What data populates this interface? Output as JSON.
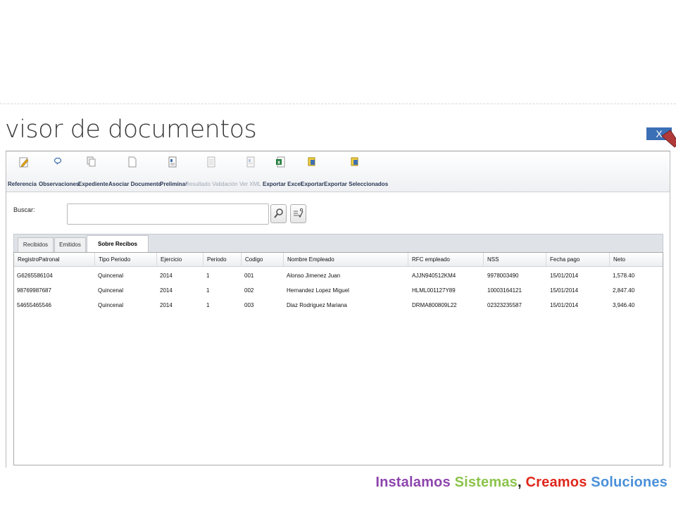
{
  "page": {
    "title": "visor de documentos",
    "close_label": "X"
  },
  "toolbar": [
    {
      "label": "Referencia",
      "icon": "pencil-icon",
      "enabled": true
    },
    {
      "label": "Observaciones",
      "icon": "comment-icon",
      "enabled": true
    },
    {
      "label": "Expediente",
      "icon": "copy-icon",
      "enabled": true
    },
    {
      "label": "Asociar Documento",
      "icon": "document-icon",
      "enabled": true
    },
    {
      "label": "Preliminar",
      "icon": "preview-icon",
      "enabled": true
    },
    {
      "label": "Resultado Validación",
      "icon": "validation-icon",
      "enabled": false
    },
    {
      "label": "Ver XML",
      "icon": "xml-icon",
      "enabled": false
    },
    {
      "label": "Exportar Excel",
      "icon": "excel-icon",
      "enabled": true
    },
    {
      "label": "Exportar",
      "icon": "export-icon",
      "enabled": true
    },
    {
      "label": "Exportar Seleccionados",
      "icon": "export-selected-icon",
      "enabled": true
    }
  ],
  "search": {
    "label": "Buscar:",
    "value": "",
    "placeholder": ""
  },
  "tabs": [
    {
      "label": "Recibidos",
      "active": false
    },
    {
      "label": "Emitidos",
      "active": false
    },
    {
      "label": "Sobre Recibos",
      "active": true
    }
  ],
  "grid": {
    "columns": [
      "RegistroPatronal",
      "Tipo Periodo",
      "Ejercicio",
      "Periodo",
      "Codigo",
      "Nombre Empleado",
      "RFC empleado",
      "NSS",
      "Fecha pago",
      "Neto"
    ],
    "rows": [
      [
        "G6265586104",
        "Quincenal",
        "2014",
        "1",
        "001",
        "Alonso Jimenez Juan",
        "AJJN940512KM4",
        "9978003490",
        "15/01/2014",
        "1,578.40"
      ],
      [
        "98769987687",
        "Quincenal",
        "2014",
        "1",
        "002",
        "Hernandez Lopez Miguel",
        "HLML001127Y89",
        "10003164121",
        "15/01/2014",
        "2,847.40"
      ],
      [
        "54655465546",
        "Quincenal",
        "2014",
        "1",
        "003",
        "Diaz Rodriguez Mariana",
        "DRMA800809L22",
        "02323235587",
        "15/01/2014",
        "3,946.40"
      ]
    ]
  },
  "slogan": {
    "word1": "Instalamos",
    "word2": "Sistemas",
    "comma": ",",
    "word3": "Creamos",
    "word4": "Soluciones",
    "colors": {
      "word1": "#8e44ad",
      "word2": "#8bc34a",
      "comma": "#222222",
      "word3": "#e0271c",
      "word4": "#4a90d9"
    }
  },
  "colors": {
    "accent": "#3b6fb6",
    "close_arrow": "#c0392b"
  }
}
